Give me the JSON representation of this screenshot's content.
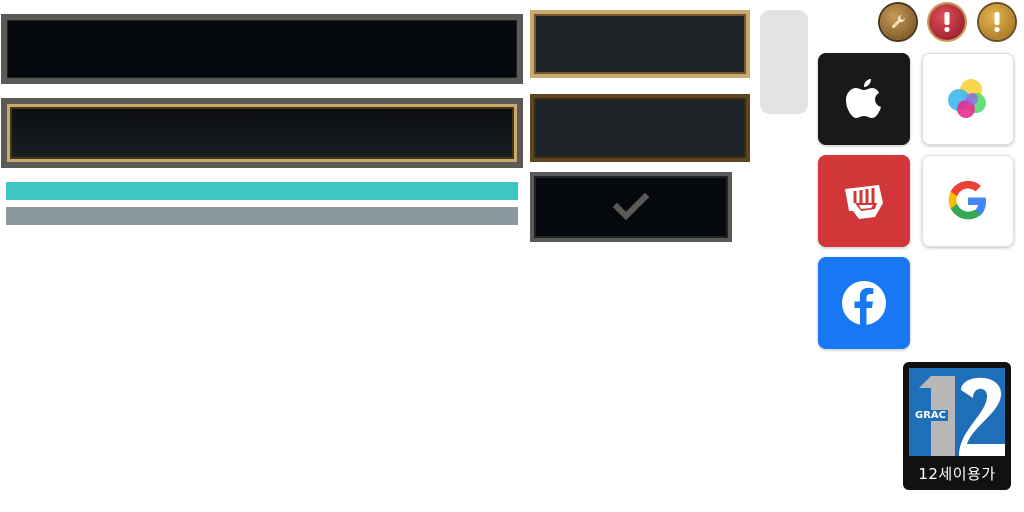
{
  "rating_badge": {
    "org": "GRAC",
    "age": "12",
    "label": "12세이용가"
  },
  "icons": {
    "wrench": "wrench-icon",
    "alert_red": "exclamation-icon",
    "alert_gold": "exclamation-icon",
    "checkmark": "checkmark-icon",
    "apple": "apple-icon",
    "game_center": "game-center-icon",
    "riot": "riot-fist-icon",
    "google": "google-icon",
    "facebook": "facebook-icon"
  },
  "colors": {
    "gold": "#c8aa6e",
    "teal": "#3ec6c4",
    "gray_bar": "#8a9a9c",
    "riot_red": "#d13639",
    "facebook_blue": "#1877f2",
    "apple_black": "#171a17"
  }
}
